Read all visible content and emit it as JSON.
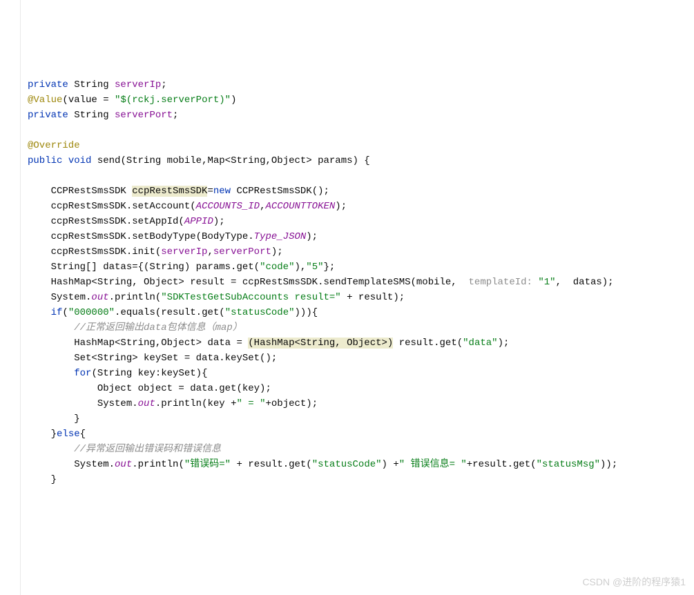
{
  "code": {
    "l1_kw1": "private",
    "l1_t": " String ",
    "l1_f": "serverIp",
    "l1_e": ";",
    "l2_a": "@Value",
    "l2_t1": "(value = ",
    "l2_s": "\"$(rckj.serverPort)\"",
    "l2_t2": ")",
    "l3_kw1": "private",
    "l3_t": " String ",
    "l3_f": "serverPort",
    "l3_e": ";",
    "l5_a": "@Override",
    "l6_kw1": "public",
    "l6_kw2": " void",
    "l6_t1": " send",
    "l6_t2": "(String mobile,Map<String,Object> params) {",
    "l8_t1": "    CCPRestSmsSDK ",
    "l8_hl": "ccpRestSmsSDK",
    "l8_t2": "=",
    "l8_kw": "new",
    "l8_t3": " CCPRestSmsSDK();",
    "l9_t1": "    ccpRestSmsSDK.setAccount(",
    "l9_f1": "ACCOUNTS_ID",
    "l9_t2": ",",
    "l9_f2": "ACCOUNTTOKEN",
    "l9_t3": ");",
    "l10_t1": "    ccpRestSmsSDK.setAppId(",
    "l10_f": "APPID",
    "l10_t2": ");",
    "l11_t1": "    ccpRestSmsSDK.setBodyType(BodyType.",
    "l11_f": "Type_JSON",
    "l11_t2": ");",
    "l12_t1": "    ccpRestSmsSDK.init(",
    "l12_f1": "serverIp",
    "l12_t2": ",",
    "l12_f2": "serverPort",
    "l12_t3": ");",
    "l13_t1": "    String[] datas={(String) params.get(",
    "l13_s1": "\"code\"",
    "l13_t2": "),",
    "l13_s2": "\"5\"",
    "l13_t3": "};",
    "l14_t1": "    HashMap<String, Object> result = ccpRestSmsSDK.sendTemplateSMS(mobile,  ",
    "l14_h": "templateId:",
    "l14_t2": " ",
    "l14_s": "\"1\"",
    "l14_t3": ",  datas);",
    "l15_t1": "    System.",
    "l15_f": "out",
    "l15_t2": ".println(",
    "l15_s": "\"SDKTestGetSubAccounts result=\"",
    "l15_t3": " + result);",
    "l16_kw": "if",
    "l16_t1": "    ",
    "l16_t1b": "(",
    "l16_s1": "\"000000\"",
    "l16_t2": ".equals(result.get(",
    "l16_s2": "\"statusCode\"",
    "l16_t3": "))){",
    "l17_c": "        //正常返回输出data包体信息（map）",
    "l18_t1": "        HashMap<String,Object> data = ",
    "l18_hl": "(HashMap<String, Object>)",
    "l18_t2": " result.get(",
    "l18_s": "\"data\"",
    "l18_t3": ");",
    "l19_t": "        Set<String> keySet = data.keySet();",
    "l20_t1": "        ",
    "l20_kw": "for",
    "l20_t2": "(String key:keySet){",
    "l21_t": "            Object object = data.get(key);",
    "l22_t1": "            System.",
    "l22_f": "out",
    "l22_t2": ".println(key +",
    "l22_s": "\" = \"",
    "l22_t3": "+object);",
    "l23_t": "        }",
    "l24_t1": "    }",
    "l24_kw": "else",
    "l24_t2": "{",
    "l25_c": "        //异常返回输出错误码和错误信息",
    "l26_t1": "        System.",
    "l26_f": "out",
    "l26_t2": ".println(",
    "l26_s1": "\"错误码=\"",
    "l26_t3": " + result.get(",
    "l26_s2": "\"statusCode\"",
    "l26_t4": ") +",
    "l26_s3": "\" 错误信息= \"",
    "l26_t5": "+result.get(",
    "l26_s4": "\"statusMsg\"",
    "l26_t6": "));",
    "l27_t": "    }"
  },
  "watermark": "CSDN @进阶的程序猿1"
}
